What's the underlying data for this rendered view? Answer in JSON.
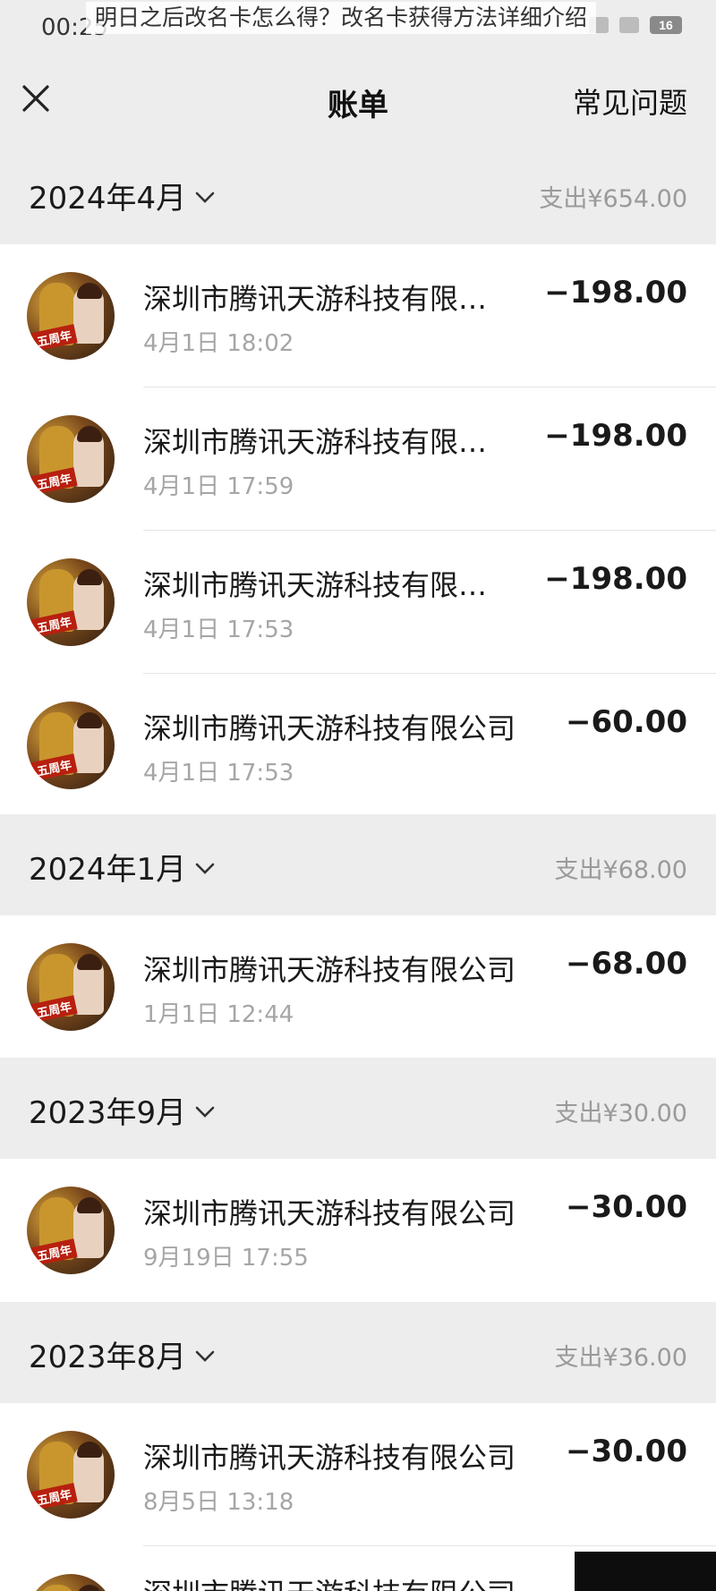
{
  "status": {
    "time": "00:25",
    "battery": "16"
  },
  "watermark_title": "明日之后改名卡怎么得？改名卡获得方法详细介绍",
  "nav": {
    "title": "账单",
    "faq": "常见问题"
  },
  "months": [
    {
      "label": "2024年4月",
      "total": "支出¥654.00"
    },
    {
      "label": "2024年1月",
      "total": "支出¥68.00"
    },
    {
      "label": "2023年9月",
      "total": "支出¥30.00"
    },
    {
      "label": "2023年8月",
      "total": "支出¥36.00"
    }
  ],
  "transactions": [
    {
      "name": "深圳市腾讯天游科技有限…",
      "time": "4月1日 18:02",
      "amount": "−198.00"
    },
    {
      "name": "深圳市腾讯天游科技有限…",
      "time": "4月1日 17:59",
      "amount": "−198.00"
    },
    {
      "name": "深圳市腾讯天游科技有限…",
      "time": "4月1日 17:53",
      "amount": "−198.00"
    },
    {
      "name": "深圳市腾讯天游科技有限公司",
      "time": "4月1日 17:53",
      "amount": "−60.00"
    },
    {
      "name": "深圳市腾讯天游科技有限公司",
      "time": "1月1日 12:44",
      "amount": "−68.00"
    },
    {
      "name": "深圳市腾讯天游科技有限公司",
      "time": "9月19日 17:55",
      "amount": "−30.00"
    },
    {
      "name": "深圳市腾讯天游科技有限公司",
      "time": "8月5日 13:18",
      "amount": "−30.00"
    },
    {
      "name": "深圳市腾讯天游科技有限公司",
      "time": "",
      "amount": ""
    }
  ],
  "avatar_badge": "五周年",
  "icons": {
    "close": "close-icon",
    "chevron": "chevron-down-icon"
  }
}
